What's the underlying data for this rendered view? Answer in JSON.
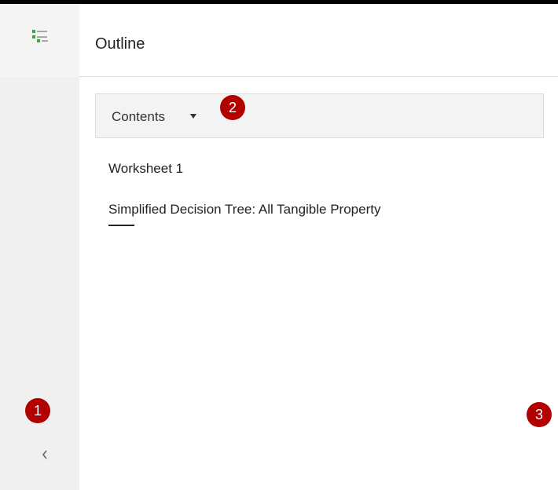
{
  "header": {
    "title": "Outline"
  },
  "contents_dropdown": {
    "label": "Contents"
  },
  "toc": {
    "items": [
      {
        "label": "Worksheet 1"
      },
      {
        "label": "Simplified Decision Tree: All Tangible Property"
      }
    ]
  },
  "callouts": [
    "1",
    "2",
    "3"
  ],
  "icons": {
    "rail_icon": "outline-list-icon",
    "collapse": "chevron-left-icon",
    "dropdown": "caret-down-icon"
  },
  "colors": {
    "accent_green": "#3aa53a",
    "callout_red": "#b00000",
    "rail_bg": "#f0f0f0",
    "bar_bg": "#f3f3f3"
  }
}
